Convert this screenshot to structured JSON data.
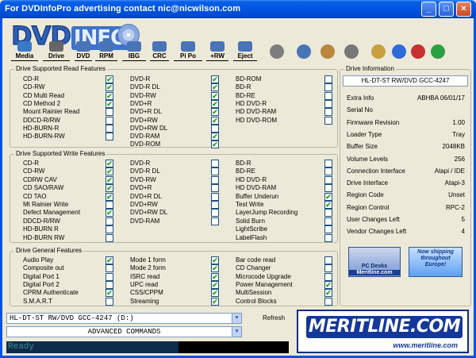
{
  "window": {
    "title": "For DVDInfoPro advertising contact nic@nicwilson.com",
    "min_label": "_",
    "max_label": "□",
    "close_label": "×"
  },
  "logo": {
    "dvd": "DVD",
    "info": "INFO",
    "pro": "PRO"
  },
  "toolbar": [
    {
      "label": "Media",
      "icon": "monitor-icon",
      "color": "#3a78c8"
    },
    {
      "label": "Drive",
      "icon": "drive-icon",
      "color": "#666666"
    },
    {
      "label": "DVD",
      "icon": "dvd-icon",
      "color": "#4a74b8"
    },
    {
      "label": "RPM",
      "icon": "rpm-icon",
      "color": "#4a74b8"
    },
    {
      "label": "IBG",
      "icon": "ibg-icon",
      "color": "#4a74b8"
    },
    {
      "label": "CRC",
      "icon": "crc-icon",
      "color": "#4a74b8"
    },
    {
      "label": "Pi Po",
      "icon": "pipo-icon",
      "color": "#4a74b8"
    },
    {
      "label": "+RW",
      "icon": "rw-icon",
      "color": "#4a74b8"
    },
    {
      "label": "Eject",
      "icon": "eject-icon",
      "color": "#4a74b8"
    }
  ],
  "right_icons": [
    {
      "icon": "disc-tool-icon",
      "color": "#7d7d7d"
    },
    {
      "icon": "dc-icon",
      "color": "#4a74b8"
    },
    {
      "icon": "clipboard-icon",
      "color": "#b8863c"
    },
    {
      "icon": "camera-icon",
      "color": "#777777"
    },
    {
      "icon": "notepad-icon",
      "color": "#c8a040"
    },
    {
      "icon": "info-icon",
      "color": "#2e6ad8"
    },
    {
      "icon": "help-icon",
      "color": "#c83030"
    },
    {
      "icon": "dollar-icon",
      "color": "#2aa040"
    }
  ],
  "read_features": {
    "title": "Drive Supported Read Features",
    "columns": [
      [
        {
          "label": "CD-R",
          "checked": true
        },
        {
          "label": "CD-RW",
          "checked": true
        },
        {
          "label": "CD Multi Read",
          "checked": true
        },
        {
          "label": "CD Method 2",
          "checked": true
        },
        {
          "label": "Mount Rainier Read",
          "checked": false
        },
        {
          "label": "DDCD-R/RW",
          "checked": false
        },
        {
          "label": "HD-BURN-R",
          "checked": false
        },
        {
          "label": "HD-BURN-RW",
          "checked": false
        }
      ],
      [
        {
          "label": "DVD-R",
          "checked": true
        },
        {
          "label": "DVD-R DL",
          "checked": true
        },
        {
          "label": "DVD-RW",
          "checked": true
        },
        {
          "label": "DVD+R",
          "checked": true
        },
        {
          "label": "DVD+R DL",
          "checked": true
        },
        {
          "label": "DVD+RW",
          "checked": true
        },
        {
          "label": "DVD+RW DL",
          "checked": false
        },
        {
          "label": "DVD-RAM",
          "checked": true
        },
        {
          "label": "DVD-ROM",
          "checked": true
        }
      ],
      [
        {
          "label": "BD-ROM",
          "checked": false
        },
        {
          "label": "BD-R",
          "checked": false
        },
        {
          "label": "BD-RE",
          "checked": false
        },
        {
          "label": "HD DVD-R",
          "checked": false
        },
        {
          "label": "HD DVD-RAM",
          "checked": false
        },
        {
          "label": "HD DVD-ROM",
          "checked": false
        }
      ]
    ]
  },
  "write_features": {
    "title": "Drive Supported Write Features",
    "columns": [
      [
        {
          "label": "CD-R",
          "checked": true
        },
        {
          "label": "CD-RW",
          "checked": true
        },
        {
          "label": "CDRW CAV",
          "checked": true
        },
        {
          "label": "CD SAO/RAW",
          "checked": true
        },
        {
          "label": "CD TAO",
          "checked": true
        },
        {
          "label": "Mt Rainier Write",
          "checked": false
        },
        {
          "label": "Defect Management",
          "checked": true
        },
        {
          "label": "DDCD-R/RW",
          "checked": false
        },
        {
          "label": "HD-BURN R",
          "checked": false
        },
        {
          "label": "HD-BURN RW",
          "checked": false
        }
      ],
      [
        {
          "label": "DVD-R",
          "checked": false
        },
        {
          "label": "DVD-R DL",
          "checked": false
        },
        {
          "label": "DVD-RW",
          "checked": false
        },
        {
          "label": "DVD+R",
          "checked": false
        },
        {
          "label": "DVD+R DL",
          "checked": false
        },
        {
          "label": "DVD+RW",
          "checked": false
        },
        {
          "label": "DVD+RW DL",
          "checked": false
        },
        {
          "label": "DVD-RAM",
          "checked": false
        }
      ],
      [
        {
          "label": "BD-R",
          "checked": false
        },
        {
          "label": "BD-RE",
          "checked": false
        },
        {
          "label": "HD DVD-R",
          "checked": false
        },
        {
          "label": "HD DVD-RAM",
          "checked": false
        },
        {
          "label": "Buffer Underun",
          "checked": true
        },
        {
          "label": "Test Write",
          "checked": true
        },
        {
          "label": "LayerJump Recording",
          "checked": false
        },
        {
          "label": "Solid Burn",
          "checked": false
        },
        {
          "label": "LightScribe",
          "checked": false
        },
        {
          "label": "LabelFlash",
          "checked": false
        }
      ]
    ]
  },
  "general_features": {
    "title": "Drive General Features",
    "columns": [
      [
        {
          "label": "Audio Play",
          "checked": true
        },
        {
          "label": "Composite out",
          "checked": false
        },
        {
          "label": "Digital Port 1",
          "checked": false
        },
        {
          "label": "Digital Port 2",
          "checked": false
        },
        {
          "label": "CPRM Authenticate",
          "checked": true
        },
        {
          "label": "S.M.A.R.T",
          "checked": false
        }
      ],
      [
        {
          "label": "Mode 1 form",
          "checked": true
        },
        {
          "label": "Mode 2 form",
          "checked": true
        },
        {
          "label": "ISRC read",
          "checked": true
        },
        {
          "label": "UPC read",
          "checked": true
        },
        {
          "label": "CSS/CPPM",
          "checked": true
        },
        {
          "label": "Streaming",
          "checked": true
        }
      ],
      [
        {
          "label": "Bar code read",
          "checked": false
        },
        {
          "label": "CD Changer",
          "checked": false
        },
        {
          "label": "Microcode Upgrade",
          "checked": false
        },
        {
          "label": "Power Management",
          "checked": true
        },
        {
          "label": "MultiSession",
          "checked": true
        },
        {
          "label": "Control Blocks",
          "checked": false
        }
      ]
    ]
  },
  "drive_info": {
    "title": "Drive Information",
    "drive_name": "HL-DT-ST RW/DVD GCC-4247",
    "rows": [
      {
        "label": "Extra Info",
        "value": "ABHBA   06/01/17"
      },
      {
        "label": "Serial No",
        "value": ""
      },
      {
        "label": "Firmware Revision",
        "value": "1.00"
      },
      {
        "label": "Loader Type",
        "value": "Tray"
      },
      {
        "label": "Buffer Size",
        "value": "2048KB"
      },
      {
        "label": "Volume Levels",
        "value": "256"
      },
      {
        "label": "Connection Interface",
        "value": "Atapi / IDE"
      },
      {
        "label": "Drive Interface",
        "value": "Atapi-3"
      },
      {
        "label": "Region Code",
        "value": "Unset"
      },
      {
        "label": "Region Control",
        "value": "RPC-2"
      },
      {
        "label": "User Changes Left",
        "value": "5"
      },
      {
        "label": "Vendor Changes Left",
        "value": "4"
      }
    ]
  },
  "banners": {
    "left_top": "PC Desks",
    "left_bottom": "Meritline.com",
    "right_line1": "Now shipping",
    "right_line2": "throughout",
    "right_line3": "Europe!"
  },
  "bottom": {
    "drive_select": "HL-DT-ST RW/DVD GCC-4247 (D:)",
    "command_select": "ADVANCED COMMANDS",
    "refresh": "Refresh",
    "status": "Ready",
    "status_progress": 0.61,
    "arrow": "▼",
    "big_banner_brand": "MERITLINE.COM",
    "big_banner_url": "www.meritline.com"
  }
}
